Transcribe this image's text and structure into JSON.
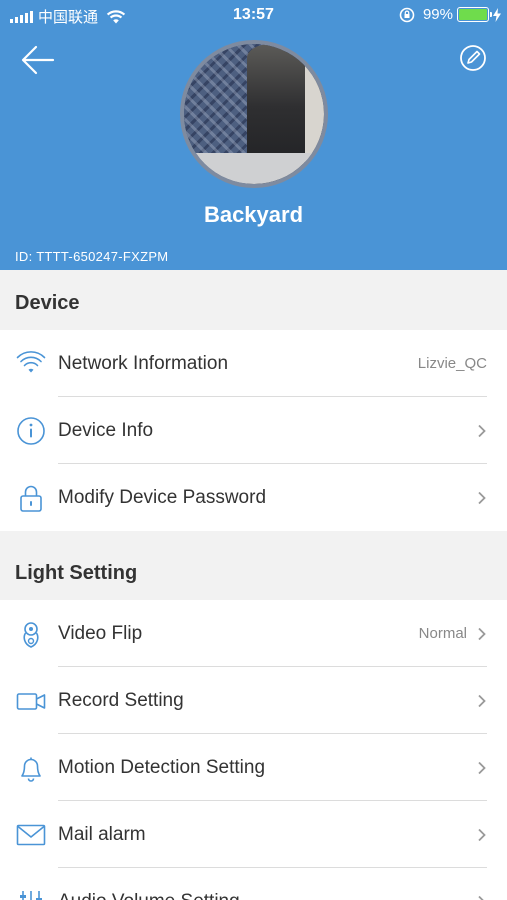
{
  "statusbar": {
    "carrier": "中国联通",
    "time": "13:57",
    "battery_percent": "99%",
    "battery_level": 0.99
  },
  "header": {
    "device_name": "Backyard",
    "device_id": "ID: TTTT-650247-FXZPM",
    "back_icon": "arrow-left-icon",
    "edit_icon": "edit-icon"
  },
  "sections": {
    "device": {
      "title": "Device",
      "items": [
        {
          "label": "Network Information",
          "value": "Lizvie_QC",
          "icon": "wifi-icon"
        },
        {
          "label": "Device Info",
          "value": "",
          "icon": "info-icon"
        },
        {
          "label": "Modify Device Password",
          "value": "",
          "icon": "lock-icon"
        }
      ]
    },
    "light": {
      "title": "Light Setting",
      "items": [
        {
          "label": "Video Flip",
          "value": "Normal",
          "icon": "camera-icon"
        },
        {
          "label": "Record Setting",
          "value": "",
          "icon": "video-camera-icon"
        },
        {
          "label": "Motion Detection Setting",
          "value": "",
          "icon": "bell-icon"
        },
        {
          "label": "Mail alarm",
          "value": "",
          "icon": "mail-icon"
        },
        {
          "label": "Audio Volume Setting",
          "value": "",
          "icon": "equalizer-icon"
        }
      ]
    }
  },
  "colors": {
    "header_bg": "#4a94d6",
    "icon_blue": "#4a94d6",
    "battery_green": "#6fdc4c"
  }
}
